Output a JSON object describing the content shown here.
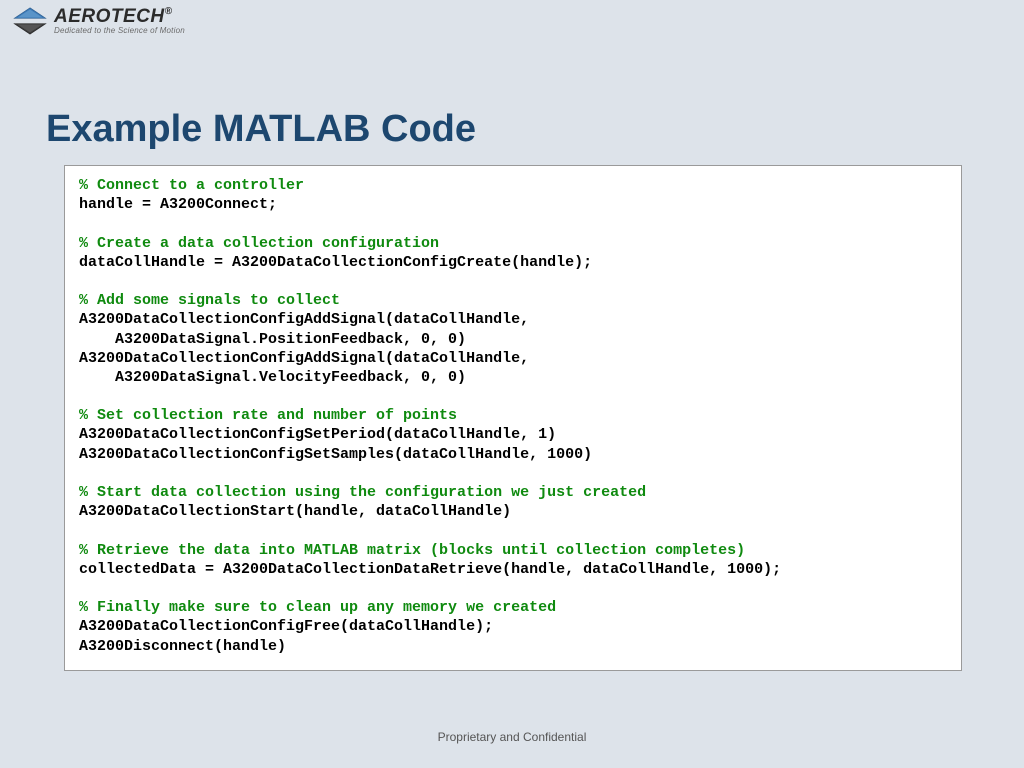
{
  "logo": {
    "brand": "AEROTECH",
    "tagline": "Dedicated to the Science of Motion",
    "registered": "®"
  },
  "title": "Example MATLAB Code",
  "code": {
    "lines": [
      {
        "type": "comment",
        "text": "% Connect to a controller"
      },
      {
        "type": "code",
        "text": "handle = A3200Connect;"
      },
      {
        "type": "blank",
        "text": ""
      },
      {
        "type": "comment",
        "text": "% Create a data collection configuration"
      },
      {
        "type": "code",
        "text": "dataCollHandle = A3200DataCollectionConfigCreate(handle);"
      },
      {
        "type": "blank",
        "text": ""
      },
      {
        "type": "comment",
        "text": "% Add some signals to collect"
      },
      {
        "type": "code",
        "text": "A3200DataCollectionConfigAddSignal(dataCollHandle,"
      },
      {
        "type": "code",
        "text": "    A3200DataSignal.PositionFeedback, 0, 0)"
      },
      {
        "type": "code",
        "text": "A3200DataCollectionConfigAddSignal(dataCollHandle,"
      },
      {
        "type": "code",
        "text": "    A3200DataSignal.VelocityFeedback, 0, 0)"
      },
      {
        "type": "blank",
        "text": ""
      },
      {
        "type": "comment",
        "text": "% Set collection rate and number of points"
      },
      {
        "type": "code",
        "text": "A3200DataCollectionConfigSetPeriod(dataCollHandle, 1)"
      },
      {
        "type": "code",
        "text": "A3200DataCollectionConfigSetSamples(dataCollHandle, 1000)"
      },
      {
        "type": "blank",
        "text": ""
      },
      {
        "type": "comment",
        "text": "% Start data collection using the configuration we just created"
      },
      {
        "type": "code",
        "text": "A3200DataCollectionStart(handle, dataCollHandle)"
      },
      {
        "type": "blank",
        "text": ""
      },
      {
        "type": "comment",
        "text": "% Retrieve the data into MATLAB matrix (blocks until collection completes)"
      },
      {
        "type": "code",
        "text": "collectedData = A3200DataCollectionDataRetrieve(handle, dataCollHandle, 1000);"
      },
      {
        "type": "blank",
        "text": ""
      },
      {
        "type": "comment",
        "text": "% Finally make sure to clean up any memory we created"
      },
      {
        "type": "code",
        "text": "A3200DataCollectionConfigFree(dataCollHandle);"
      },
      {
        "type": "code",
        "text": "A3200Disconnect(handle)"
      }
    ]
  },
  "footer": "Proprietary and Confidential"
}
